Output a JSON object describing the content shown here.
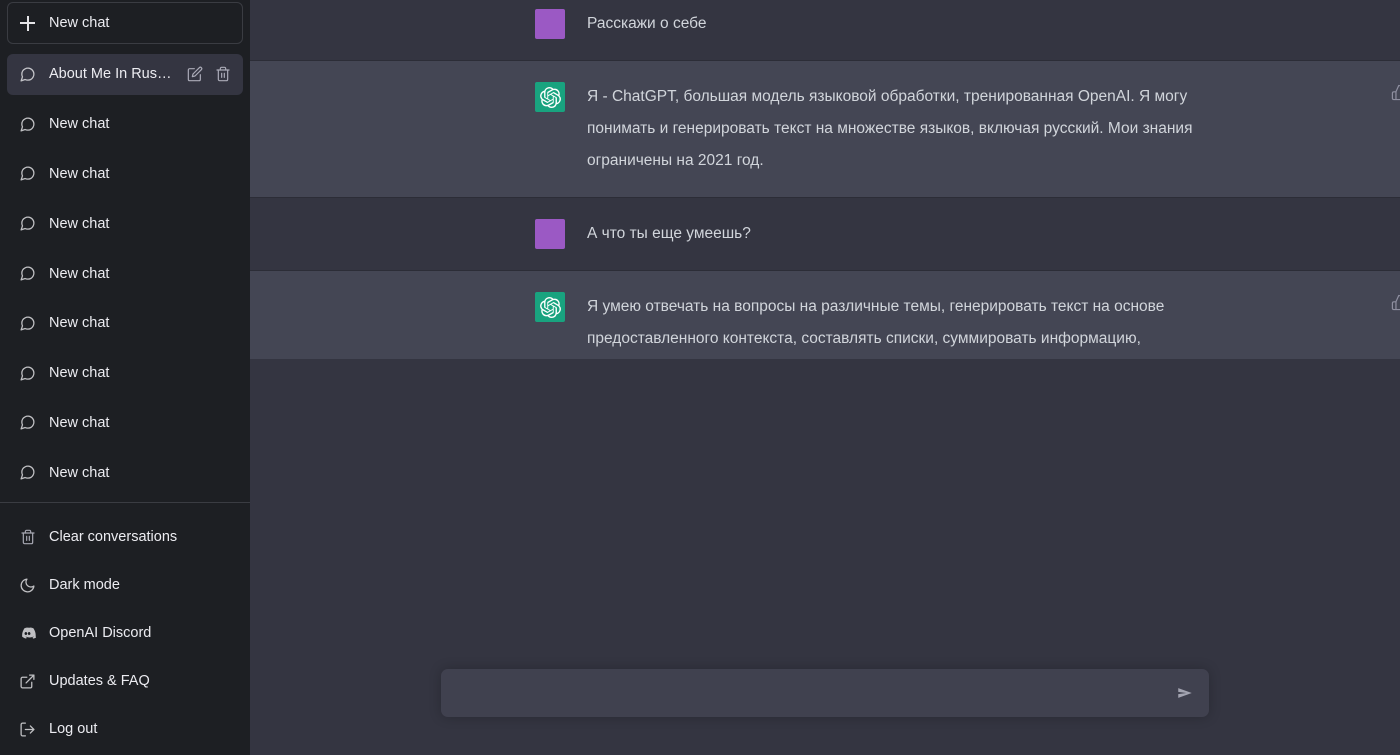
{
  "sidebar": {
    "new_chat": {
      "label": "New chat",
      "icon": "plus-icon"
    },
    "chats": [
      {
        "label": "About Me In Russian",
        "active": true,
        "icon": "chat-bubble-icon"
      },
      {
        "label": "New chat",
        "active": false,
        "icon": "chat-bubble-icon"
      },
      {
        "label": "New chat",
        "active": false,
        "icon": "chat-bubble-icon"
      },
      {
        "label": "New chat",
        "active": false,
        "icon": "chat-bubble-icon"
      },
      {
        "label": "New chat",
        "active": false,
        "icon": "chat-bubble-icon"
      },
      {
        "label": "New chat",
        "active": false,
        "icon": "chat-bubble-icon"
      },
      {
        "label": "New chat",
        "active": false,
        "icon": "chat-bubble-icon"
      },
      {
        "label": "New chat",
        "active": false,
        "icon": "chat-bubble-icon"
      },
      {
        "label": "New chat",
        "active": false,
        "icon": "chat-bubble-icon"
      }
    ],
    "item_actions": {
      "edit": "edit-pencil-icon",
      "delete": "trash-icon"
    },
    "footer": [
      {
        "label": "Clear conversations",
        "icon": "trash-icon"
      },
      {
        "label": "Dark mode",
        "icon": "moon-icon"
      },
      {
        "label": "OpenAI Discord",
        "icon": "discord-icon"
      },
      {
        "label": "Updates & FAQ",
        "icon": "external-link-icon"
      },
      {
        "label": "Log out",
        "icon": "logout-icon"
      }
    ]
  },
  "conversation": {
    "messages": [
      {
        "role": "user",
        "avatar": "user-avatar",
        "text": "Расскажи о себе"
      },
      {
        "role": "assistant",
        "avatar": "openai-logo-icon",
        "text": "Я - ChatGPT, большая модель языковой обработки, тренированная OpenAI. Я могу понимать и генерировать текст на множестве языков, включая русский. Мои знания ограничены на 2021 год."
      },
      {
        "role": "user",
        "avatar": "user-avatar",
        "text": "А что ты еще умеешь?"
      },
      {
        "role": "assistant",
        "avatar": "openai-logo-icon",
        "text": "Я умею отвечать на вопросы на различные темы, генерировать текст на основе предоставленного контекста, составлять списки, суммировать информацию, переводить текст на различные языки и многое другое. Я могу использоваться в широком спектре приложений, таких как генерация текста, обработка естественного языка, анализ тональности, вопросно-ответная система и многое другое."
      }
    ],
    "feedback": {
      "up": "thumbs-up-icon",
      "down": "thumbs-down-icon"
    }
  },
  "composer": {
    "value": "",
    "placeholder": "",
    "send_icon": "send-arrow-icon"
  },
  "colors": {
    "sidebar_bg": "#1d1f23",
    "user_msg_bg": "#343541",
    "assistant_msg_bg": "#444654",
    "composer_bg": "#40414f",
    "user_avatar": "#9b59c4",
    "assistant_avatar": "#19a37f",
    "text_primary": "#ececf1",
    "text_body": "#d1d5db"
  }
}
